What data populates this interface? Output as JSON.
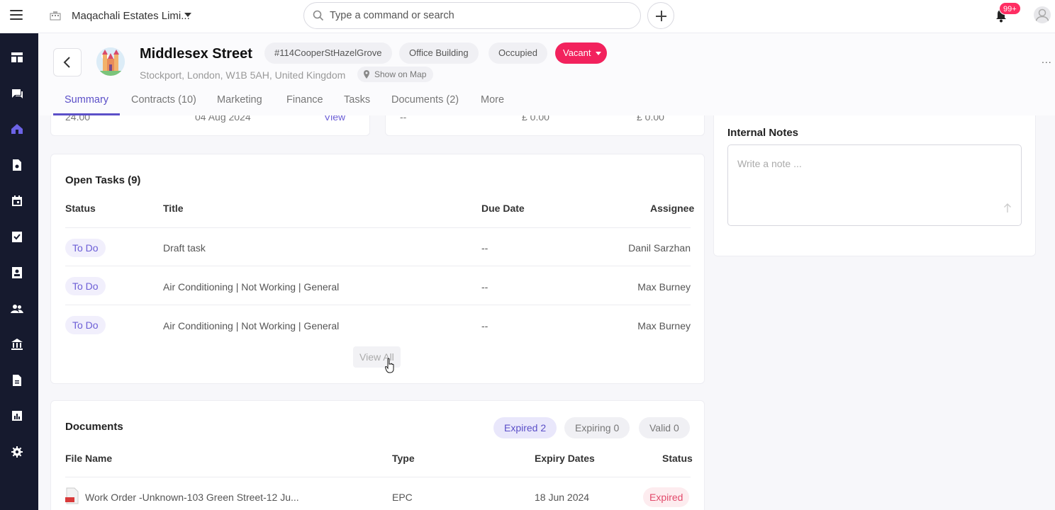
{
  "topbar": {
    "organization": "Maqachali Estates Limi...",
    "search_placeholder": "Type a command or search",
    "notification_count": "99+"
  },
  "header": {
    "title": "Middlesex Street",
    "tags": [
      "#114CooperStHazelGrove",
      "Office Building",
      "Occupied"
    ],
    "status": "Vacant",
    "address": "Stockport, London, W1B 5AH, United Kingdom",
    "map_link": "Show on Map",
    "more": "..."
  },
  "tabs": [
    "Summary",
    "Contracts (10)",
    "Marketing",
    "Finance",
    "Tasks",
    "Documents (2)",
    "More"
  ],
  "open_tasks": {
    "title": "Open Tasks (9)",
    "columns": [
      "Status",
      "Title",
      "Due Date",
      "Assignee"
    ],
    "rows": [
      {
        "status": "To Do",
        "title": "Draft task",
        "due": "--",
        "assignee": "Danil Sarzhan"
      },
      {
        "status": "To Do",
        "title": "Air Conditioning | Not Working | General",
        "due": "--",
        "assignee": "Max Burney"
      },
      {
        "status": "To Do",
        "title": "Air Conditioning | Not Working | General",
        "due": "--",
        "assignee": "Max Burney"
      }
    ],
    "view_all": "View All"
  },
  "documents": {
    "title": "Documents",
    "filters": [
      "Expired 2",
      "Expiring 0",
      "Valid 0"
    ],
    "columns": [
      "File Name",
      "Type",
      "Expiry Dates",
      "Status"
    ],
    "rows": [
      {
        "file": "Work Order -Unknown-103 Green Street-12 Ju...",
        "type": "EPC",
        "expiry": "18 Jun 2024",
        "status": "Expired"
      }
    ]
  },
  "internal_notes": {
    "title": "Internal Notes",
    "placeholder": "Write a note ..."
  },
  "top_cards": {
    "left": [
      "24.00",
      "04 Aug 2024",
      "View"
    ],
    "right": [
      "--",
      "£ 0.00",
      "£ 0.00"
    ]
  },
  "colors": {
    "accent": "#5b4fc8",
    "vacant": "#f2225d",
    "sidebar": "#161a2e",
    "expired": "#e24a6b"
  }
}
